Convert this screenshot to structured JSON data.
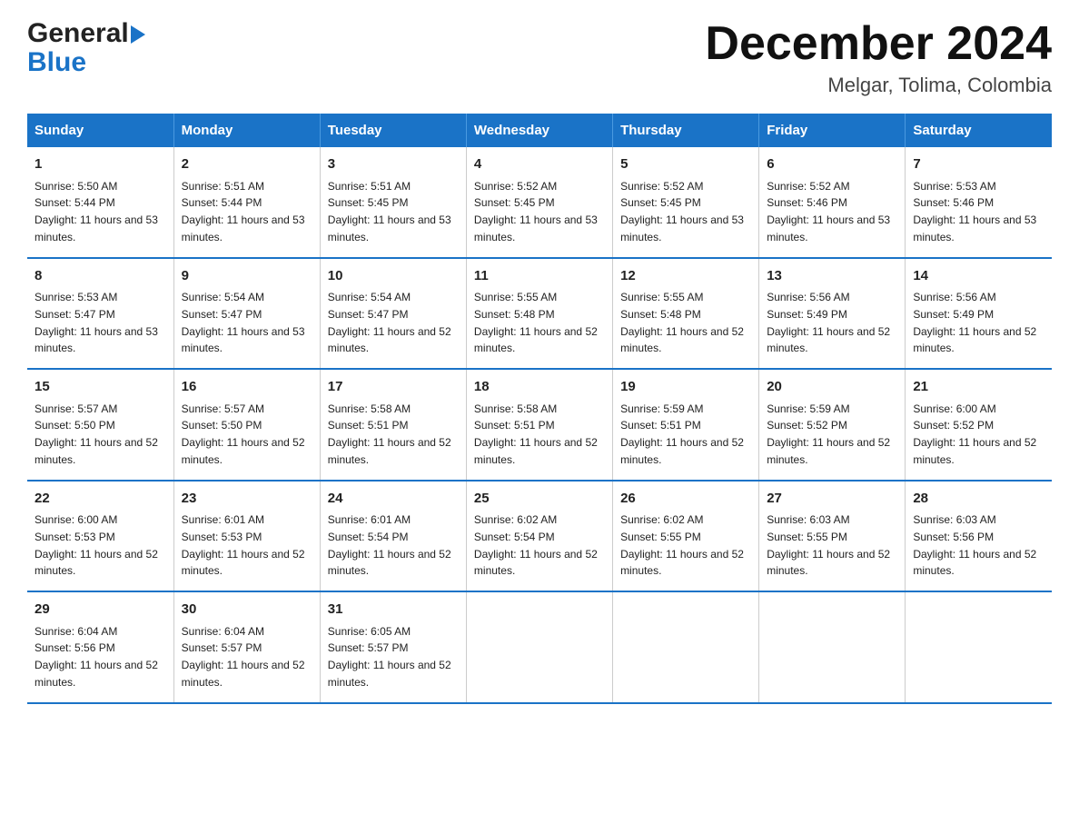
{
  "header": {
    "logo": {
      "general": "General",
      "blue": "Blue",
      "arrow_color": "#1a73c7"
    },
    "title": "December 2024",
    "location": "Melgar, Tolima, Colombia"
  },
  "calendar": {
    "days_of_week": [
      "Sunday",
      "Monday",
      "Tuesday",
      "Wednesday",
      "Thursday",
      "Friday",
      "Saturday"
    ],
    "weeks": [
      [
        {
          "day": "1",
          "sunrise": "5:50 AM",
          "sunset": "5:44 PM",
          "daylight": "11 hours and 53 minutes."
        },
        {
          "day": "2",
          "sunrise": "5:51 AM",
          "sunset": "5:44 PM",
          "daylight": "11 hours and 53 minutes."
        },
        {
          "day": "3",
          "sunrise": "5:51 AM",
          "sunset": "5:45 PM",
          "daylight": "11 hours and 53 minutes."
        },
        {
          "day": "4",
          "sunrise": "5:52 AM",
          "sunset": "5:45 PM",
          "daylight": "11 hours and 53 minutes."
        },
        {
          "day": "5",
          "sunrise": "5:52 AM",
          "sunset": "5:45 PM",
          "daylight": "11 hours and 53 minutes."
        },
        {
          "day": "6",
          "sunrise": "5:52 AM",
          "sunset": "5:46 PM",
          "daylight": "11 hours and 53 minutes."
        },
        {
          "day": "7",
          "sunrise": "5:53 AM",
          "sunset": "5:46 PM",
          "daylight": "11 hours and 53 minutes."
        }
      ],
      [
        {
          "day": "8",
          "sunrise": "5:53 AM",
          "sunset": "5:47 PM",
          "daylight": "11 hours and 53 minutes."
        },
        {
          "day": "9",
          "sunrise": "5:54 AM",
          "sunset": "5:47 PM",
          "daylight": "11 hours and 53 minutes."
        },
        {
          "day": "10",
          "sunrise": "5:54 AM",
          "sunset": "5:47 PM",
          "daylight": "11 hours and 52 minutes."
        },
        {
          "day": "11",
          "sunrise": "5:55 AM",
          "sunset": "5:48 PM",
          "daylight": "11 hours and 52 minutes."
        },
        {
          "day": "12",
          "sunrise": "5:55 AM",
          "sunset": "5:48 PM",
          "daylight": "11 hours and 52 minutes."
        },
        {
          "day": "13",
          "sunrise": "5:56 AM",
          "sunset": "5:49 PM",
          "daylight": "11 hours and 52 minutes."
        },
        {
          "day": "14",
          "sunrise": "5:56 AM",
          "sunset": "5:49 PM",
          "daylight": "11 hours and 52 minutes."
        }
      ],
      [
        {
          "day": "15",
          "sunrise": "5:57 AM",
          "sunset": "5:50 PM",
          "daylight": "11 hours and 52 minutes."
        },
        {
          "day": "16",
          "sunrise": "5:57 AM",
          "sunset": "5:50 PM",
          "daylight": "11 hours and 52 minutes."
        },
        {
          "day": "17",
          "sunrise": "5:58 AM",
          "sunset": "5:51 PM",
          "daylight": "11 hours and 52 minutes."
        },
        {
          "day": "18",
          "sunrise": "5:58 AM",
          "sunset": "5:51 PM",
          "daylight": "11 hours and 52 minutes."
        },
        {
          "day": "19",
          "sunrise": "5:59 AM",
          "sunset": "5:51 PM",
          "daylight": "11 hours and 52 minutes."
        },
        {
          "day": "20",
          "sunrise": "5:59 AM",
          "sunset": "5:52 PM",
          "daylight": "11 hours and 52 minutes."
        },
        {
          "day": "21",
          "sunrise": "6:00 AM",
          "sunset": "5:52 PM",
          "daylight": "11 hours and 52 minutes."
        }
      ],
      [
        {
          "day": "22",
          "sunrise": "6:00 AM",
          "sunset": "5:53 PM",
          "daylight": "11 hours and 52 minutes."
        },
        {
          "day": "23",
          "sunrise": "6:01 AM",
          "sunset": "5:53 PM",
          "daylight": "11 hours and 52 minutes."
        },
        {
          "day": "24",
          "sunrise": "6:01 AM",
          "sunset": "5:54 PM",
          "daylight": "11 hours and 52 minutes."
        },
        {
          "day": "25",
          "sunrise": "6:02 AM",
          "sunset": "5:54 PM",
          "daylight": "11 hours and 52 minutes."
        },
        {
          "day": "26",
          "sunrise": "6:02 AM",
          "sunset": "5:55 PM",
          "daylight": "11 hours and 52 minutes."
        },
        {
          "day": "27",
          "sunrise": "6:03 AM",
          "sunset": "5:55 PM",
          "daylight": "11 hours and 52 minutes."
        },
        {
          "day": "28",
          "sunrise": "6:03 AM",
          "sunset": "5:56 PM",
          "daylight": "11 hours and 52 minutes."
        }
      ],
      [
        {
          "day": "29",
          "sunrise": "6:04 AM",
          "sunset": "5:56 PM",
          "daylight": "11 hours and 52 minutes."
        },
        {
          "day": "30",
          "sunrise": "6:04 AM",
          "sunset": "5:57 PM",
          "daylight": "11 hours and 52 minutes."
        },
        {
          "day": "31",
          "sunrise": "6:05 AM",
          "sunset": "5:57 PM",
          "daylight": "11 hours and 52 minutes."
        },
        null,
        null,
        null,
        null
      ]
    ]
  }
}
